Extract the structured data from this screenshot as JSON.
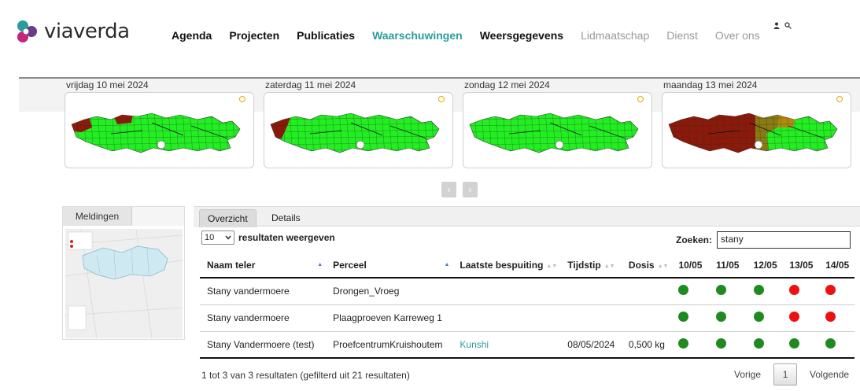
{
  "brand": {
    "name": "viaverda"
  },
  "nav": [
    {
      "label": "Agenda",
      "state": "dark"
    },
    {
      "label": "Projecten",
      "state": "dark"
    },
    {
      "label": "Publicaties",
      "state": "dark"
    },
    {
      "label": "Waarschuwingen",
      "state": "active"
    },
    {
      "label": "Weersgegevens",
      "state": "dark"
    },
    {
      "label": "Lidmaatschap",
      "state": "muted"
    },
    {
      "label": "Dienst",
      "state": "muted"
    },
    {
      "label": "Over ons",
      "state": "muted"
    }
  ],
  "forecast": [
    {
      "date": "vrijdag 10 mei 2024",
      "risk": "low-west"
    },
    {
      "date": "zaterdag 11 mei 2024",
      "risk": "low-west-edge"
    },
    {
      "date": "zondag 12 mei 2024",
      "risk": "none"
    },
    {
      "date": "maandag 13 mei 2024",
      "risk": "high"
    }
  ],
  "left_panel": {
    "tab_label": "Meldingen"
  },
  "tabs": [
    {
      "label": "Overzicht",
      "active": true
    },
    {
      "label": "Details",
      "active": false
    }
  ],
  "table_controls": {
    "length_value": "10",
    "length_label": "resultaten weergeven",
    "search_label": "Zoeken:",
    "search_value": "stany"
  },
  "table": {
    "headers": [
      "Naam teler",
      "Perceel",
      "Laatste bespuiting",
      "Tijdstip",
      "Dosis",
      "10/05",
      "11/05",
      "12/05",
      "13/05",
      "14/05"
    ],
    "rows": [
      {
        "naam": "Stany vandermoere",
        "perceel": "Drongen_Vroeg",
        "bespuiting": "",
        "tijdstip": "",
        "dosis": "",
        "status": [
          "green",
          "green",
          "green",
          "red",
          "red"
        ]
      },
      {
        "naam": "Stany vandermoere",
        "perceel": "Plaagproeven Karreweg 1",
        "bespuiting": "",
        "tijdstip": "",
        "dosis": "",
        "status": [
          "green",
          "green",
          "green",
          "red",
          "red"
        ]
      },
      {
        "naam": "Stany Vandermoere (test)",
        "perceel": "ProefcentrumKruishoutem",
        "bespuiting": "Kunshi",
        "tijdstip": "08/05/2024",
        "dosis": "0,500 kg",
        "status": [
          "green",
          "green",
          "green",
          "green",
          "green"
        ]
      }
    ]
  },
  "footer": {
    "info": "1 tot 3 van 3 resultaten (gefilterd uit 21 resultaten)",
    "prev": "Vorige",
    "page": "1",
    "next": "Volgende"
  },
  "colors": {
    "accent": "#2a9d9a",
    "green": "#1f8a1f",
    "red": "#ee1111",
    "map_green": "#22ee22",
    "map_red": "#8b1a0a"
  }
}
